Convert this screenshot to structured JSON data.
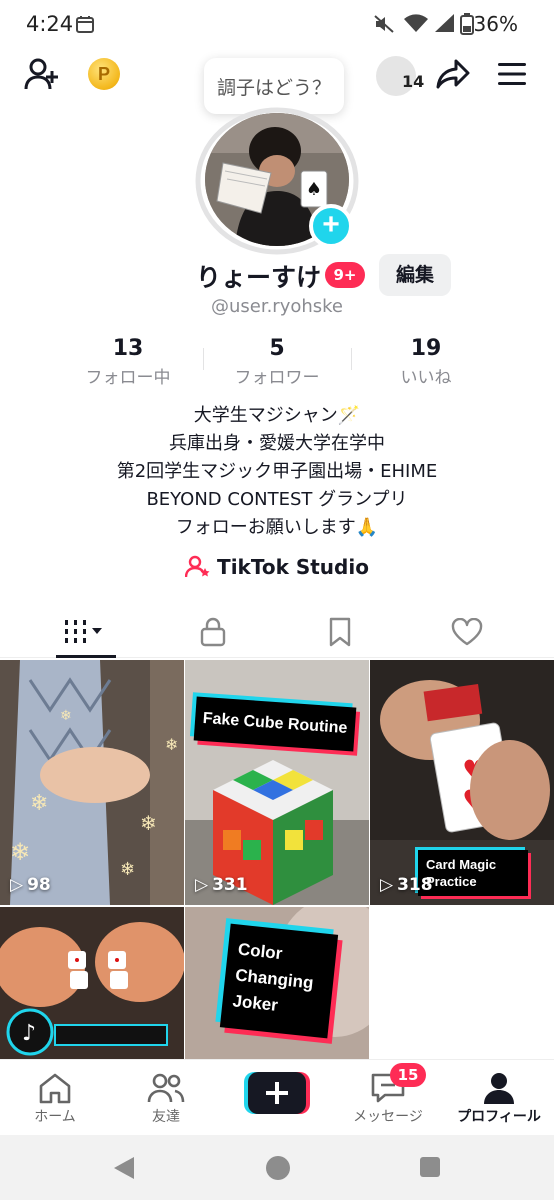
{
  "status_bar": {
    "time": "4:24",
    "battery": "36%"
  },
  "top_bar": {
    "coin_label": "P",
    "mood_bubble": "調子はどう？",
    "profile_views": "14"
  },
  "profile": {
    "display_name": "りょーすけ",
    "notification_badge": "9+",
    "edit_label": "編集",
    "username": "@user.ryohske",
    "stats": [
      {
        "value": "13",
        "label": "フォロー中"
      },
      {
        "value": "5",
        "label": "フォロワー"
      },
      {
        "value": "19",
        "label": "いいね"
      }
    ],
    "bio_lines": [
      "大学生マジシャン🪄",
      "兵庫出身・愛媛大学在学中",
      "第2回学生マジック甲子園出場・EHIME",
      "BEYOND CONTEST グランプリ",
      "フォローお願いします🙏"
    ],
    "studio_link": "TikTok Studio"
  },
  "videos": [
    {
      "views": "98"
    },
    {
      "views": "331",
      "overlay": "Fake Cube Routine"
    },
    {
      "views": "318",
      "overlay": "Card Magic Practice"
    },
    {
      "views": ""
    },
    {
      "views": "",
      "overlay": "Color Changing Joker"
    }
  ],
  "bottom_nav": {
    "items": [
      {
        "label": "ホーム"
      },
      {
        "label": "友達"
      },
      {
        "label": "メッセージ"
      },
      {
        "label": "プロフィール"
      }
    ],
    "messages_badge": "15"
  },
  "colors": {
    "accent": "#fe2c55",
    "cyan": "#20d5ec",
    "text": "#161823",
    "muted": "#8a8b91"
  }
}
